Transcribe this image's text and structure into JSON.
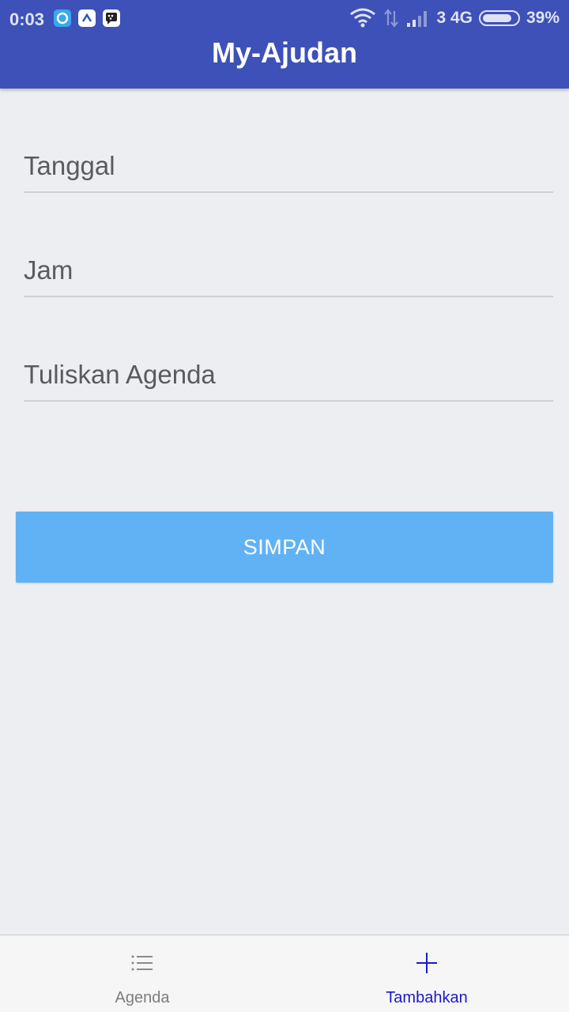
{
  "status_bar": {
    "time": "0:03",
    "network_text": "3 4G",
    "battery_text": "39%",
    "battery_level": 0.39,
    "notification_icons": [
      "circle-app-icon",
      "arrow-app-icon",
      "bbm-app-icon"
    ]
  },
  "header": {
    "title": "My-Ajudan"
  },
  "form": {
    "tanggal_placeholder": "Tanggal",
    "jam_placeholder": "Jam",
    "agenda_placeholder": "Tuliskan Agenda",
    "save_label": "SIMPAN"
  },
  "bottom_nav": {
    "items": [
      {
        "label": "Agenda",
        "icon": "list-icon",
        "active": false
      },
      {
        "label": "Tambahkan",
        "icon": "plus-icon",
        "active": true
      }
    ]
  },
  "colors": {
    "header": "#3d51b8",
    "background": "#edeef2",
    "save_button": "#61b2f4",
    "nav_active": "#1a1ac8",
    "nav_inactive": "#7d7d7d"
  }
}
